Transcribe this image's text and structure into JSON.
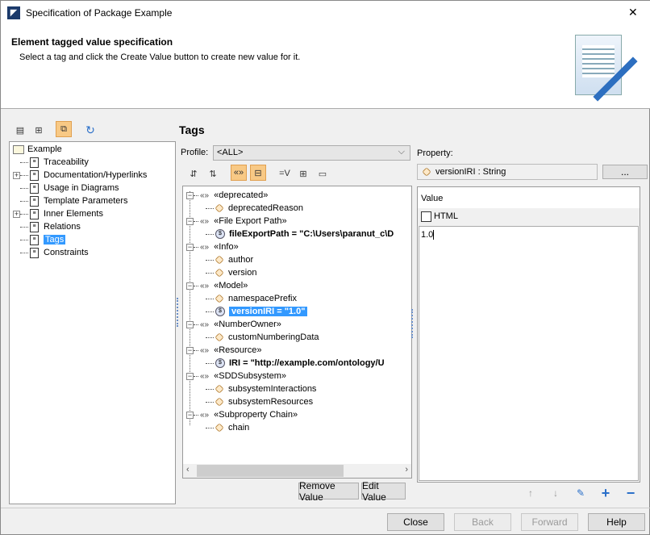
{
  "window": {
    "title": "Specification of Package Example",
    "close": "✕"
  },
  "header": {
    "title": "Element tagged value specification",
    "subtitle": "Select a tag and click the Create Value button to create new value for it."
  },
  "left_tree": {
    "root": "Example",
    "items": [
      {
        "label": "Traceability",
        "expandable": false
      },
      {
        "label": "Documentation/Hyperlinks",
        "expandable": true
      },
      {
        "label": "Usage in Diagrams",
        "expandable": false
      },
      {
        "label": "Template Parameters",
        "expandable": false
      },
      {
        "label": "Inner Elements",
        "expandable": true
      },
      {
        "label": "Relations",
        "expandable": false
      },
      {
        "label": "Tags",
        "expandable": false,
        "selected": true
      },
      {
        "label": "Constraints",
        "expandable": false
      }
    ]
  },
  "tags": {
    "heading": "Tags",
    "profile_label": "Profile:",
    "profile_value": "<ALL>",
    "rows": [
      {
        "kind": "stereo",
        "label": "«deprecated»"
      },
      {
        "kind": "prop",
        "label": "deprecatedReason"
      },
      {
        "kind": "stereo",
        "label": "«File Export Path»"
      },
      {
        "kind": "value",
        "label": "fileExportPath = \"C:\\Users\\paranut_c\\D"
      },
      {
        "kind": "stereo",
        "label": "«Info»"
      },
      {
        "kind": "prop",
        "label": "author"
      },
      {
        "kind": "prop",
        "label": "version"
      },
      {
        "kind": "stereo",
        "label": "«Model»"
      },
      {
        "kind": "prop",
        "label": "namespacePrefix"
      },
      {
        "kind": "value",
        "label": "versionIRI = \"1.0\"",
        "selected": true
      },
      {
        "kind": "stereo",
        "label": "«NumberOwner»"
      },
      {
        "kind": "prop",
        "label": "customNumberingData"
      },
      {
        "kind": "stereo",
        "label": "«Resource»"
      },
      {
        "kind": "value",
        "label": "IRI = \"http://example.com/ontology/U"
      },
      {
        "kind": "stereo",
        "label": "«SDDSubsystem»"
      },
      {
        "kind": "prop",
        "label": "subsystemInteractions"
      },
      {
        "kind": "prop",
        "label": "subsystemResources"
      },
      {
        "kind": "stereo",
        "label": "«Subproperty Chain»"
      },
      {
        "kind": "prop",
        "label": "chain"
      }
    ],
    "remove_value": "Remove Value",
    "edit_value": "Edit Value"
  },
  "property": {
    "label": "Property:",
    "value": "versionIRI : String",
    "browse": "...",
    "value_header": "Value",
    "html_label": "HTML",
    "html_checked": false,
    "text": "1.0"
  },
  "footer": {
    "close": "Close",
    "back": "Back",
    "forward": "Forward",
    "help": "Help"
  },
  "colors": {
    "selection": "#3399ff",
    "toggle": "#f8c985"
  }
}
